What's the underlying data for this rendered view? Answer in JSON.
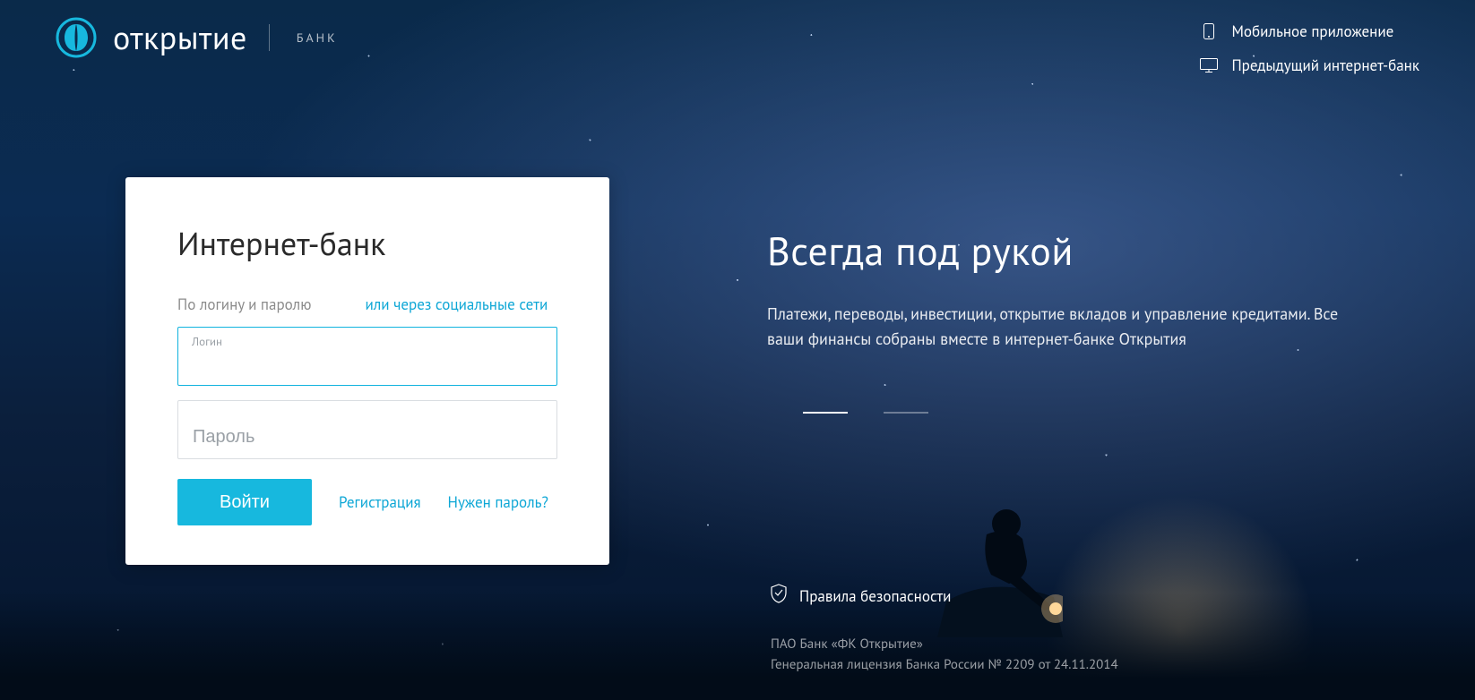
{
  "brand": {
    "name": "открытие",
    "sub": "БАНК"
  },
  "topnav": {
    "mobile": "Мобильное приложение",
    "legacy": "Предыдущий интернет-банк"
  },
  "login": {
    "title": "Интернет-банк",
    "tab_credentials": "По логину и паролю",
    "tab_social": "или через социальные сети",
    "login_label": "Логин",
    "password_placeholder": "Пароль",
    "submit": "Войти",
    "register": "Регистрация",
    "forgot": "Нужен пароль?"
  },
  "hero": {
    "headline": "Всегда под рукой",
    "body": "Платежи, переводы, инвестиции, открытие вкладов и управление кредитами. Все ваши финансы собраны вместе в интернет-банке Открытия"
  },
  "footer": {
    "security": "Правила безопасности",
    "legal1": "ПАО Банк «ФК Открытие»",
    "legal2": "Генеральная лицензия Банка России № 2209 от 24.11.2014"
  },
  "colors": {
    "accent": "#17b8de",
    "link": "#0ea7d6"
  }
}
